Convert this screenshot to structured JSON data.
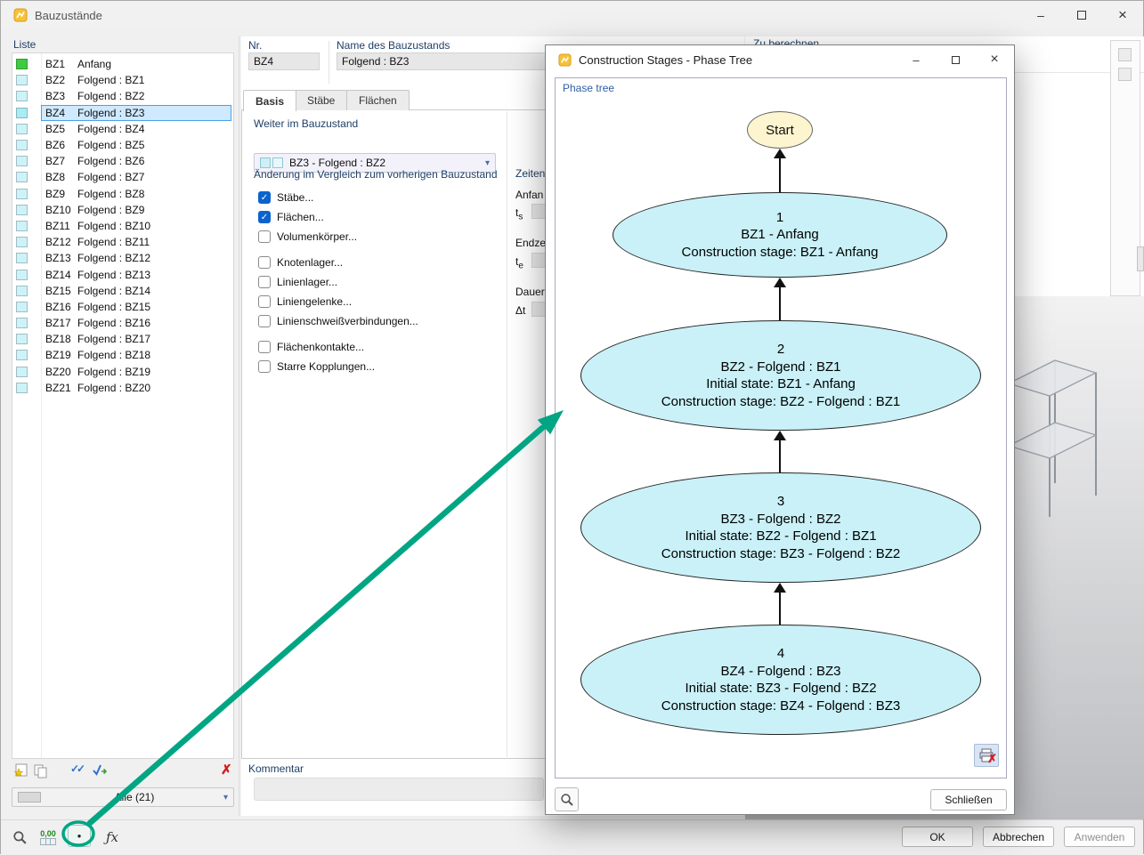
{
  "window": {
    "title": "Bauzustände"
  },
  "icons": {
    "minimize": "–",
    "close": "×",
    "chevron": "▾",
    "check": "✓",
    "double_check": "✓✓",
    "delete": "✗",
    "dot": "●",
    "fx": "ƒx",
    "star": "★"
  },
  "list_panel": {
    "header": "Liste",
    "filter_value": "Alle (21)",
    "items": [
      {
        "id": "BZ1",
        "label": "Anfang",
        "color": "#3ecb3e",
        "selected": false
      },
      {
        "id": "BZ2",
        "label": "Folgend : BZ1",
        "color": "#cdf3f8",
        "selected": false
      },
      {
        "id": "BZ3",
        "label": "Folgend : BZ2",
        "color": "#cdf3f8",
        "selected": false
      },
      {
        "id": "BZ4",
        "label": "Folgend : BZ3",
        "color": "#a8ecf4",
        "selected": true
      },
      {
        "id": "BZ5",
        "label": "Folgend : BZ4",
        "color": "#cdf3f8",
        "selected": false
      },
      {
        "id": "BZ6",
        "label": "Folgend : BZ5",
        "color": "#cdf3f8",
        "selected": false
      },
      {
        "id": "BZ7",
        "label": "Folgend : BZ6",
        "color": "#cdf3f8",
        "selected": false
      },
      {
        "id": "BZ8",
        "label": "Folgend : BZ7",
        "color": "#cdf3f8",
        "selected": false
      },
      {
        "id": "BZ9",
        "label": "Folgend : BZ8",
        "color": "#cdf3f8",
        "selected": false
      },
      {
        "id": "BZ10",
        "label": "Folgend : BZ9",
        "color": "#cdf3f8",
        "selected": false
      },
      {
        "id": "BZ11",
        "label": "Folgend : BZ10",
        "color": "#cdf3f8",
        "selected": false
      },
      {
        "id": "BZ12",
        "label": "Folgend : BZ11",
        "color": "#cdf3f8",
        "selected": false
      },
      {
        "id": "BZ13",
        "label": "Folgend : BZ12",
        "color": "#cdf3f8",
        "selected": false
      },
      {
        "id": "BZ14",
        "label": "Folgend : BZ13",
        "color": "#cdf3f8",
        "selected": false
      },
      {
        "id": "BZ15",
        "label": "Folgend : BZ14",
        "color": "#cdf3f8",
        "selected": false
      },
      {
        "id": "BZ16",
        "label": "Folgend : BZ15",
        "color": "#cdf3f8",
        "selected": false
      },
      {
        "id": "BZ17",
        "label": "Folgend : BZ16",
        "color": "#cdf3f8",
        "selected": false
      },
      {
        "id": "BZ18",
        "label": "Folgend : BZ17",
        "color": "#cdf3f8",
        "selected": false
      },
      {
        "id": "BZ19",
        "label": "Folgend : BZ18",
        "color": "#cdf3f8",
        "selected": false
      },
      {
        "id": "BZ20",
        "label": "Folgend : BZ19",
        "color": "#cdf3f8",
        "selected": false
      },
      {
        "id": "BZ21",
        "label": "Folgend : BZ20",
        "color": "#cdf3f8",
        "selected": false
      }
    ]
  },
  "form": {
    "nr_label": "Nr.",
    "nr_value": "BZ4",
    "name_label": "Name des Bauzustands",
    "name_value": "Folgend : BZ3",
    "tabs": [
      {
        "label": "Basis"
      },
      {
        "label": "Stäbe"
      },
      {
        "label": "Flächen"
      }
    ],
    "weiter_header": "Weiter im Bauzustand",
    "weiter_value": "BZ3 - Folgend : BZ2",
    "aenderung_header": "Änderung im Vergleich zum vorherigen Bauzustand",
    "checkboxes": [
      {
        "label": "Stäbe...",
        "checked": true,
        "gap": false
      },
      {
        "label": "Flächen...",
        "checked": true,
        "gap": false
      },
      {
        "label": "Volumenkörper...",
        "checked": false,
        "gap": false
      },
      {
        "label": "Knotenlager...",
        "checked": false,
        "gap": true
      },
      {
        "label": "Linienlager...",
        "checked": false,
        "gap": false
      },
      {
        "label": "Liniengelenke...",
        "checked": false,
        "gap": false
      },
      {
        "label": "Linienschweißverbindungen...",
        "checked": false,
        "gap": false
      },
      {
        "label": "Flächenkontakte...",
        "checked": false,
        "gap": true
      },
      {
        "label": "Starre Kopplungen...",
        "checked": false,
        "gap": false
      }
    ],
    "zeiten_header": "Zeiten",
    "zeiten_rows": [
      {
        "label": "Anfan",
        "sym": "t",
        "sub": "s"
      },
      {
        "label": "Endze",
        "sym": "t",
        "sub": "e"
      },
      {
        "label": "Dauer",
        "sym": "Δt",
        "sub": ""
      }
    ],
    "kommentar_label": "Kommentar"
  },
  "right_panel": {
    "header": "Zu berechnen"
  },
  "dialog": {
    "title": "Construction Stages - Phase Tree",
    "tree_label": "Phase tree",
    "start_label": "Start",
    "nodes": [
      {
        "lines": [
          "1",
          "BZ1 - Anfang",
          "Construction stage: BZ1 - Anfang"
        ]
      },
      {
        "lines": [
          "2",
          "BZ2 - Folgend : BZ1",
          "Initial state: BZ1 - Anfang",
          "Construction stage: BZ2 - Folgend : BZ1"
        ]
      },
      {
        "lines": [
          "3",
          "BZ3 - Folgend : BZ2",
          "Initial state: BZ2 - Folgend : BZ1",
          "Construction stage: BZ3 - Folgend : BZ2"
        ]
      },
      {
        "lines": [
          "4",
          "BZ4 - Folgend : BZ3",
          "Initial state: BZ3 - Folgend : BZ2",
          "Construction stage: BZ4 - Folgend : BZ3"
        ]
      }
    ],
    "close_label": "Schließen"
  },
  "toolbar": {
    "decimal": "0,00"
  },
  "footer": {
    "ok": "OK",
    "cancel": "Abbrechen",
    "apply": "Anwenden"
  },
  "colors": {
    "annotation": "#00a583",
    "node_fill": "#c9f1f7",
    "start_fill": "#fdf5cf",
    "accent": "#0a63cc",
    "stage_green": "#3ecb3e",
    "stage_cyan": "#cdf3f8",
    "selection": "#cfe9ff"
  }
}
